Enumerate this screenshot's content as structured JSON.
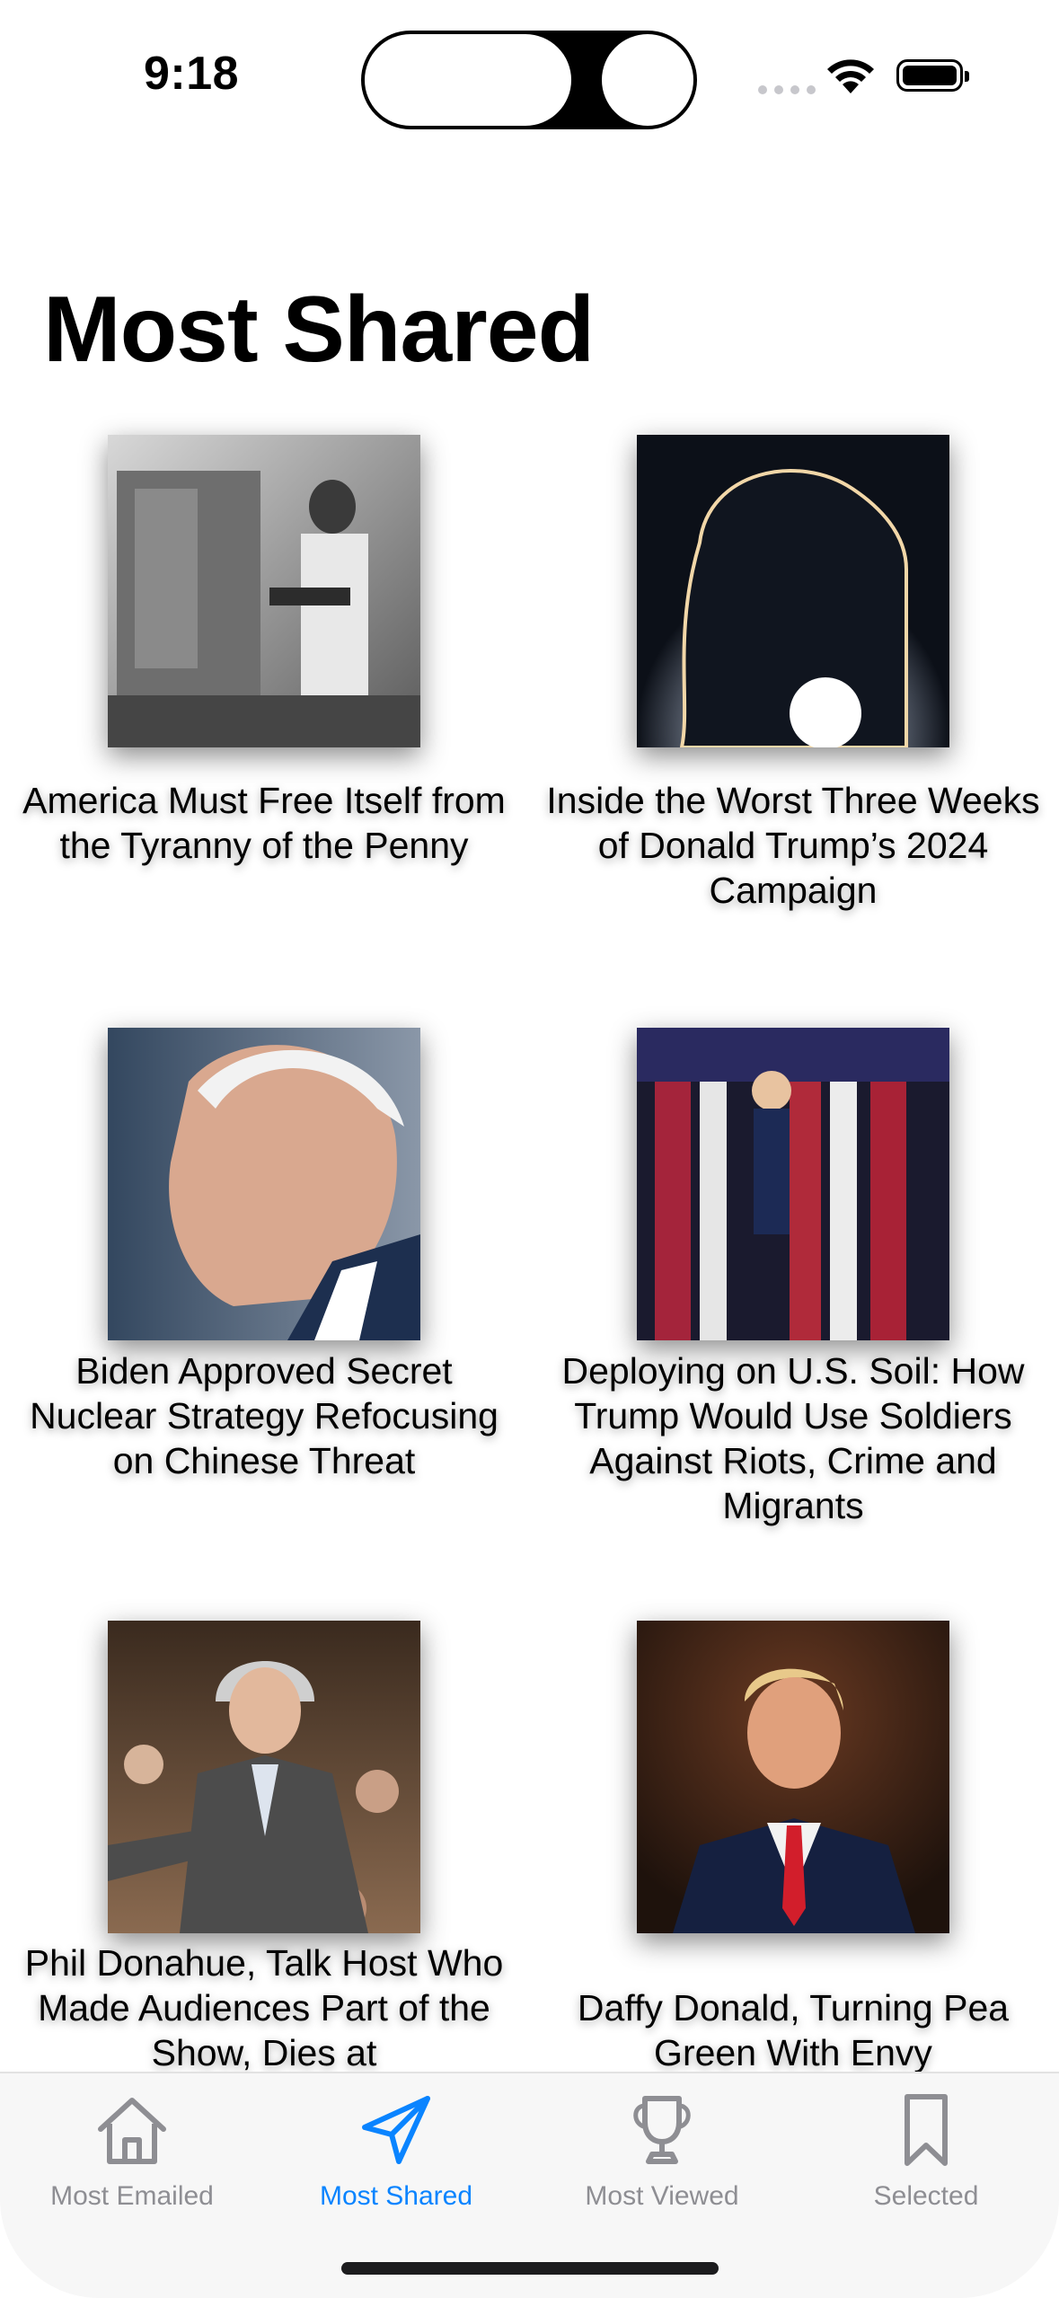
{
  "status_bar": {
    "time": "9:18"
  },
  "header": {
    "title": "Most Shared"
  },
  "articles": [
    {
      "headline": "America Must Free Itself from the Tyranny of the Penny",
      "image": "vintage-factory-worker-photo"
    },
    {
      "headline": "Inside the Worst Three Weeks of Donald Trump’s 2024 Campaign",
      "image": "silhouette-backlit-photo"
    },
    {
      "headline": "Biden Approved Secret Nuclear Strategy Refocusing on Chinese Threat",
      "image": "biden-portrait-photo"
    },
    {
      "headline": "Deploying on U.S. Soil: How Trump Would Use Soldiers Against Riots, Crime and Migrants",
      "image": "trump-flags-photo"
    },
    {
      "headline": "Phil Donahue, Talk Host Who Made Audiences Part of the Show, Dies at",
      "image": "donahue-audience-photo"
    },
    {
      "headline": "Daffy Donald, Turning Pea Green With Envy",
      "image": "trump-portrait-photo"
    }
  ],
  "tabbar": {
    "tabs": [
      {
        "label": "Most Emailed",
        "icon": "house-icon",
        "active": false
      },
      {
        "label": "Most Shared",
        "icon": "paper-plane-icon",
        "active": true
      },
      {
        "label": "Most Viewed",
        "icon": "trophy-icon",
        "active": false
      },
      {
        "label": "Selected",
        "icon": "bookmark-icon",
        "active": false
      }
    ]
  },
  "colors": {
    "accent": "#0a84ff",
    "inactive": "#8e8e93"
  }
}
